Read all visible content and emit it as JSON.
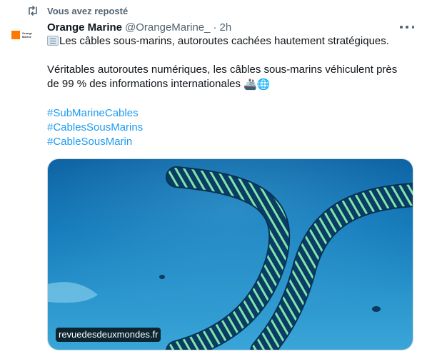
{
  "repost": {
    "label": "Vous avez reposté",
    "icon": "repost-icon"
  },
  "tweet": {
    "avatar": {
      "brand": "Orange Marine",
      "lines": [
        "Orange",
        "Marine"
      ],
      "color": "#ff7900"
    },
    "author_name": "Orange Marine",
    "author_handle": "@OrangeMarine_",
    "separator": "·",
    "time": "2h",
    "more_icon": "more-horizontal-icon",
    "text_line1": "Les câbles sous-marins, autoroutes cachées hautement stratégiques.",
    "text_line2": "Véritables autoroutes numériques, les câbles sous-marins véhiculent près",
    "text_line3": "de 99 % des informations internationales",
    "emojis": {
      "newspaper": "newspaper-icon",
      "ship": "🚢",
      "globe": "🌐"
    },
    "hashtags": [
      "#SubMarineCables",
      "#CablesSousMarins",
      "#CableSousMarin"
    ],
    "media": {
      "source": "revuedesdeuxmondes.fr",
      "description_icon": "undersea-cable-image"
    }
  },
  "colors": {
    "accent": "#1d9bf0",
    "text": "#0f1419",
    "muted": "#536471",
    "brand": "#ff7900"
  }
}
